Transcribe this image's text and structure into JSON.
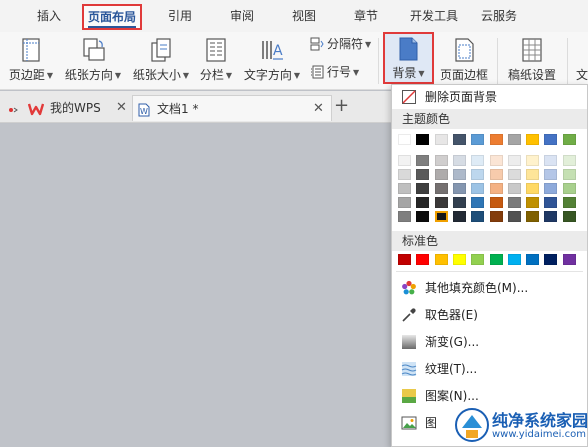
{
  "menubar": {
    "items": [
      "插入",
      "页面布局",
      "引用",
      "审阅",
      "视图",
      "章节",
      "开发工具",
      "云服务"
    ],
    "active_index": 1
  },
  "ribbon": {
    "margins": "页边距",
    "orientation": "纸张方向",
    "size": "纸张大小",
    "columns": "分栏",
    "text_direction": "文字方向",
    "separator": "分隔符",
    "line_number": "行号",
    "background": "背景",
    "page_border": "页面边框",
    "paper_setting": "稿纸设置",
    "cut_off": "文"
  },
  "tabs": [
    {
      "title": "我的WPS",
      "icon": "wps-logo-icon"
    },
    {
      "title": "文档1 *",
      "icon": "document-icon"
    }
  ],
  "background_menu": {
    "remove_background": "删除页面背景",
    "theme_colors_title": "主题颜色",
    "theme_top_row": [
      "#ffffff",
      "#000000",
      "#e7e6e6",
      "#44546a",
      "#5b9bd5",
      "#ed7d31",
      "#a5a5a5",
      "#ffc000",
      "#4472c4",
      "#70ad47"
    ],
    "theme_shades": [
      [
        "#f2f2f2",
        "#7f7f7f",
        "#d0cece",
        "#d6dce4",
        "#deebf6",
        "#fbe5d5",
        "#ededed",
        "#fff2cc",
        "#dae3f3",
        "#e2efd9"
      ],
      [
        "#d9d9d9",
        "#595959",
        "#aeabab",
        "#adb9ca",
        "#bdd7ee",
        "#f7cbac",
        "#dbdbdb",
        "#fee599",
        "#b4c6e7",
        "#c5e0b3"
      ],
      [
        "#bfbfbf",
        "#3f3f3f",
        "#757070",
        "#8496b0",
        "#9cc3e5",
        "#f4b183",
        "#c9c9c9",
        "#ffd965",
        "#8eaadb",
        "#a8d08d"
      ],
      [
        "#a5a5a5",
        "#262626",
        "#3a3838",
        "#323f4f",
        "#2e75b5",
        "#c55a11",
        "#7b7b7b",
        "#bf9000",
        "#2f5496",
        "#538135"
      ],
      [
        "#7f7f7f",
        "#0c0c0c",
        "#171616",
        "#222a35",
        "#1e4e79",
        "#833c0b",
        "#525252",
        "#7f6000",
        "#1f3864",
        "#375623"
      ]
    ],
    "standard_colors_title": "标准色",
    "standard_colors": [
      "#c00000",
      "#ff0000",
      "#ffc000",
      "#ffff00",
      "#92d050",
      "#00b050",
      "#00b0f0",
      "#0070c0",
      "#002060",
      "#7030a0"
    ],
    "items": [
      {
        "label": "其他填充颜色(M)...",
        "icon": "color-wheel-icon"
      },
      {
        "label": "取色器(E)",
        "icon": "eyedropper-icon"
      },
      {
        "label": "渐变(G)...",
        "icon": "gradient-icon"
      },
      {
        "label": "纹理(T)...",
        "icon": "texture-icon"
      },
      {
        "label": "图案(N)...",
        "icon": "pattern-icon"
      },
      {
        "label": "图",
        "icon": "picture-icon"
      }
    ]
  },
  "watermark": {
    "main": "纯净系统家园",
    "url": "www.yidaimei.com"
  }
}
